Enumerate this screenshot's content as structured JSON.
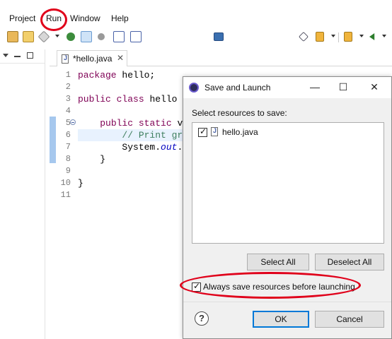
{
  "menubar": {
    "items": [
      "Project",
      "Run",
      "Window",
      "Help"
    ]
  },
  "toolbar": {
    "icons": [
      "new-project-icon",
      "open-folder-icon",
      "run-launcher-icon",
      "external-tools-icon",
      "highlight-icon",
      "link-icon",
      "toggle-breadcrumb-icon",
      "show-whitespace-icon",
      "console-icon",
      "pin-icon",
      "next-annotation-icon",
      "previous-annotation-icon",
      "back-icon"
    ]
  },
  "editor": {
    "tab_label": "*hello.java",
    "tab_close": "✕",
    "line_numbers": [
      "1",
      "2",
      "3",
      "4",
      "5",
      "6",
      "7",
      "8",
      "9",
      "10",
      "11"
    ],
    "code_lines": [
      {
        "parts": [
          {
            "t": "package",
            "c": "kw"
          },
          {
            "t": " hello;",
            "c": ""
          }
        ]
      },
      {
        "parts": []
      },
      {
        "parts": [
          {
            "t": "public",
            "c": "kw"
          },
          {
            "t": " ",
            "c": ""
          },
          {
            "t": "class",
            "c": "kw"
          },
          {
            "t": " hello",
            "c": ""
          }
        ]
      },
      {
        "parts": []
      },
      {
        "parts": [
          {
            "t": "    ",
            "c": ""
          },
          {
            "t": "public",
            "c": "kw"
          },
          {
            "t": " ",
            "c": ""
          },
          {
            "t": "static",
            "c": "kw"
          },
          {
            "t": " v",
            "c": ""
          }
        ]
      },
      {
        "parts": [
          {
            "t": "        // Print gr",
            "c": "cm"
          }
        ]
      },
      {
        "parts": [
          {
            "t": "        System.",
            "c": ""
          },
          {
            "t": "out",
            "c": "fld"
          },
          {
            "t": ".",
            "c": ""
          }
        ]
      },
      {
        "parts": [
          {
            "t": "    }",
            "c": ""
          }
        ]
      },
      {
        "parts": []
      },
      {
        "parts": [
          {
            "t": "}",
            "c": ""
          }
        ]
      },
      {
        "parts": []
      }
    ]
  },
  "dialog": {
    "title": "Save and Launch",
    "minimize": "—",
    "maximize": "☐",
    "close": "✕",
    "resources_label": "Select resources to save:",
    "resources": [
      {
        "name": "hello.java",
        "checked": true
      }
    ],
    "select_all": "Select All",
    "deselect_all": "Deselect All",
    "always_save_label": "Always save resources before launching",
    "always_save_checked": true,
    "ok": "OK",
    "cancel": "Cancel",
    "help": "?"
  },
  "annotations": {
    "color": "#e0001a"
  }
}
